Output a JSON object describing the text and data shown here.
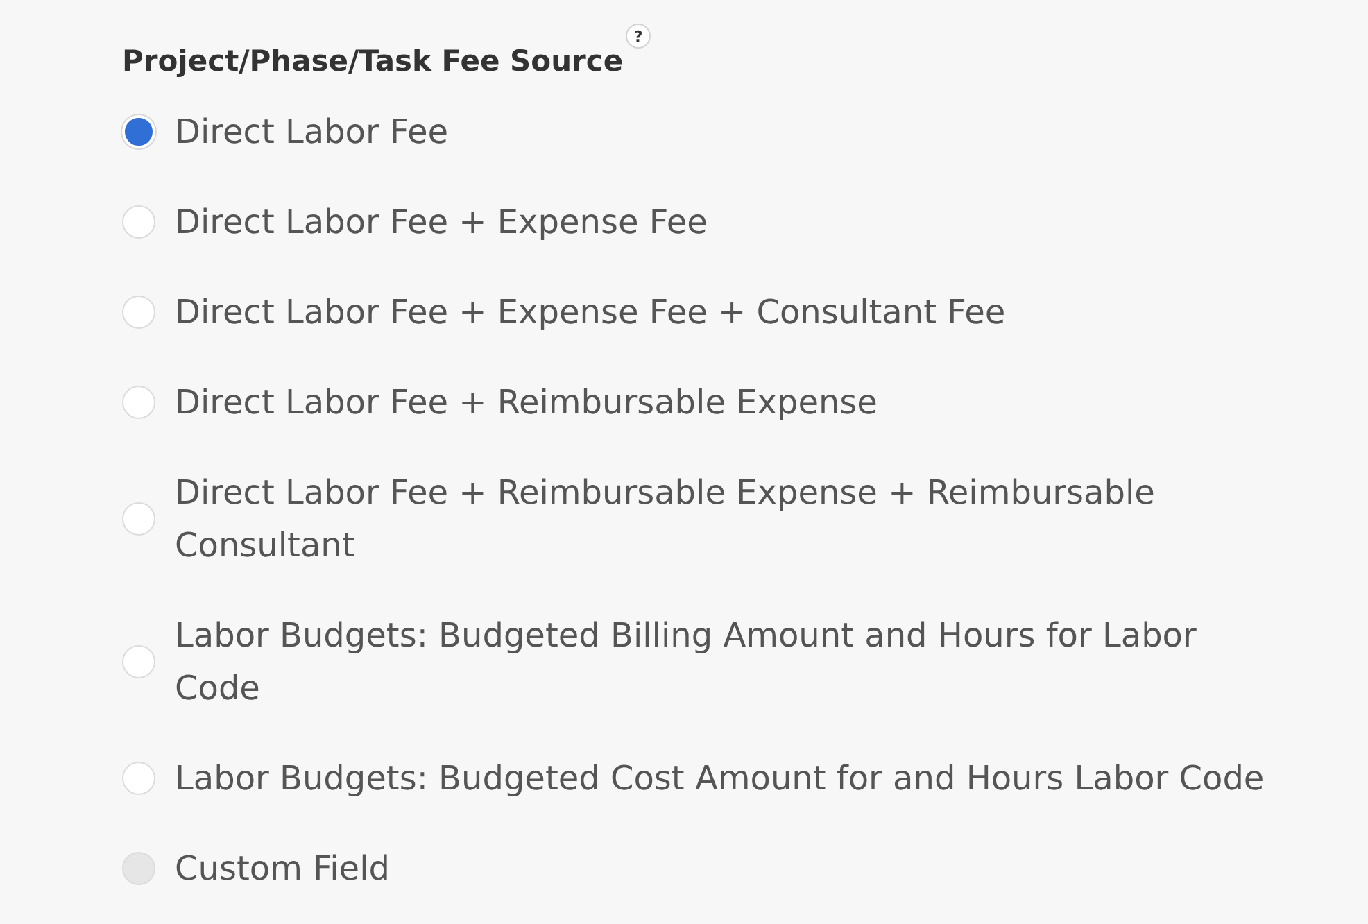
{
  "field": {
    "label": "Project/Phase/Task Fee Source",
    "help": "?"
  },
  "options": [
    {
      "label": "Direct Labor Fee",
      "selected": true,
      "disabled": false
    },
    {
      "label": "Direct Labor Fee + Expense Fee",
      "selected": false,
      "disabled": false
    },
    {
      "label": "Direct Labor Fee + Expense Fee + Consultant Fee",
      "selected": false,
      "disabled": false
    },
    {
      "label": "Direct Labor Fee + Reimbursable Expense",
      "selected": false,
      "disabled": false
    },
    {
      "label": "Direct Labor Fee + Reimbursable Expense + Reimbursable Consultant",
      "selected": false,
      "disabled": false
    },
    {
      "label": "Labor Budgets: Budgeted Billing Amount and Hours for Labor Code",
      "selected": false,
      "disabled": false
    },
    {
      "label": "Labor Budgets: Budgeted Cost Amount for and Hours Labor Code",
      "selected": false,
      "disabled": false
    },
    {
      "label": "Custom Field",
      "selected": false,
      "disabled": true
    }
  ]
}
